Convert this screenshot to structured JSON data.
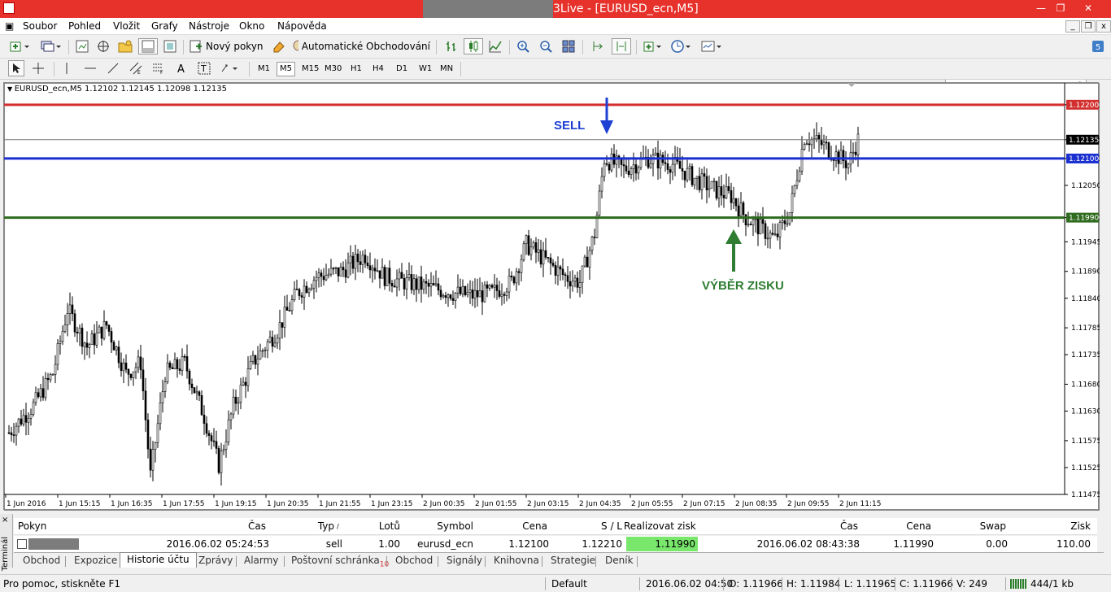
{
  "window": {
    "title": "3Live - [EURUSD_ecn,M5]",
    "close": "✕",
    "maximize": "❐",
    "minimize": "—"
  },
  "menu": {
    "items": [
      "Soubor",
      "Pohled",
      "Vložit",
      "Grafy",
      "Nástroje",
      "Okno",
      "Nápověda"
    ]
  },
  "toolbar": {
    "new_order": "Nový pokyn",
    "auto_trading": "Automatické Obchodování",
    "search_placeholder": ""
  },
  "timeframes": [
    "M1",
    "M5",
    "M15",
    "M30",
    "H1",
    "H4",
    "D1",
    "W1",
    "MN"
  ],
  "active_timeframe": "M5",
  "chart": {
    "header": "EURUSD_ecn,M5  1.12102 1.12145 1.12098 1.12135"
  },
  "annotations": {
    "sell": "SELL",
    "take_profit": "VÝBĚR ZISKU"
  },
  "colors": {
    "sell_arrow": "#1e3fd4",
    "tp_arrow": "#2e7d32",
    "tp_line": "#d32f2f",
    "entry_line": "#1a2fd0",
    "exit_line": "#2e6b1e",
    "title_bar": "#e7312b"
  },
  "chart_data": {
    "type": "candlestick",
    "symbol": "EURUSD_ecn",
    "timeframe": "M5",
    "ylim": [
      1.11475,
      1.1223
    ],
    "y_ticks": [
      "1.12200",
      "1.12135",
      "1.12100",
      "1.12050",
      "1.11990",
      "1.11945",
      "1.11890",
      "1.11840",
      "1.11785",
      "1.11735",
      "1.11680",
      "1.11630",
      "1.11575",
      "1.11525",
      "1.11475"
    ],
    "x_ticks": [
      "1 Jun 2016",
      "1 Jun 15:15",
      "1 Jun 16:35",
      "1 Jun 17:55",
      "1 Jun 19:15",
      "1 Jun 20:35",
      "1 Jun 21:55",
      "1 Jun 23:15",
      "2 Jun 00:35",
      "2 Jun 01:55",
      "2 Jun 03:15",
      "2 Jun 04:35",
      "2 Jun 05:55",
      "2 Jun 07:15",
      "2 Jun 08:35",
      "2 Jun 09:55",
      "2 Jun 11:15"
    ],
    "levels": [
      {
        "name": "Take Profit",
        "value": 1.122,
        "label": "1.12200",
        "color": "#d32f2f"
      },
      {
        "name": "Bid",
        "value": 1.12135,
        "label": "1.12135",
        "color": "#777777"
      },
      {
        "name": "Entry",
        "value": 1.121,
        "label": "1.12100",
        "color": "#1a2fd0"
      },
      {
        "name": "Exit",
        "value": 1.1199,
        "label": "1.11990",
        "color": "#2e6b1e"
      }
    ],
    "close_path": [
      [
        0,
        1.1159
      ],
      [
        10,
        1.1164
      ],
      [
        18,
        1.117
      ],
      [
        24,
        1.1182
      ],
      [
        32,
        1.1175
      ],
      [
        40,
        1.1179
      ],
      [
        48,
        1.117
      ],
      [
        54,
        1.1172
      ],
      [
        58,
        1.1151
      ],
      [
        64,
        1.117
      ],
      [
        72,
        1.1172
      ],
      [
        80,
        1.1162
      ],
      [
        86,
        1.1153
      ],
      [
        92,
        1.1164
      ],
      [
        100,
        1.1172
      ],
      [
        110,
        1.1178
      ],
      [
        118,
        1.1185
      ],
      [
        126,
        1.1188
      ],
      [
        136,
        1.1189
      ],
      [
        146,
        1.1192
      ],
      [
        154,
        1.1188
      ],
      [
        162,
        1.1187
      ],
      [
        172,
        1.1186
      ],
      [
        182,
        1.1185
      ],
      [
        190,
        1.11845
      ],
      [
        198,
        1.1185
      ],
      [
        206,
        1.1187
      ],
      [
        212,
        1.1194
      ],
      [
        220,
        1.1191
      ],
      [
        228,
        1.1188
      ],
      [
        234,
        1.1187
      ],
      [
        240,
        1.1196
      ],
      [
        244,
        1.121
      ],
      [
        252,
        1.1208
      ],
      [
        262,
        1.121
      ],
      [
        272,
        1.1209
      ],
      [
        282,
        1.1206
      ],
      [
        290,
        1.1204
      ],
      [
        296,
        1.1203
      ],
      [
        302,
        1.1199
      ],
      [
        308,
        1.1197
      ],
      [
        314,
        1.1195
      ],
      [
        320,
        1.12
      ],
      [
        326,
        1.1214
      ],
      [
        332,
        1.1213
      ],
      [
        338,
        1.1211
      ],
      [
        344,
        1.1209
      ],
      [
        348,
        1.12135
      ]
    ],
    "series": [
      {
        "name": "EURUSD_ecn",
        "open_last": 1.12102,
        "high_last": 1.12145,
        "low_last": 1.12098,
        "close_last": 1.12135
      }
    ]
  },
  "terminal": {
    "label": "Terminál",
    "close": "×",
    "columns": [
      "Pokyn",
      "Čas",
      "Typ",
      "Lotů",
      "Symbol",
      "Cena",
      "S / L",
      "Realizovat zisk",
      "Čas",
      "Cena",
      "Swap",
      "Zisk"
    ],
    "rows": [
      {
        "order": "",
        "open_time": "2016.06.02 05:24:53",
        "type": "sell",
        "lots": "1.00",
        "symbol": "eurusd_ecn",
        "open_price": "1.12100",
        "sl": "1.12210",
        "tp": "1.11990",
        "close_time": "2016.06.02 08:43:38",
        "close_price": "1.11990",
        "swap": "0.00",
        "profit": "110.00"
      }
    ],
    "tabs": [
      "Obchod",
      "Expozice",
      "Historie účtu",
      "Zprávy",
      "Alarmy",
      "Poštovní schránka",
      "Obchod",
      "Signály",
      "Knihovna",
      "Strategie",
      "Deník"
    ],
    "active_tab": "Historie účtu",
    "mailbox_count": "10"
  },
  "status": {
    "help": "Pro pomoc, stiskněte F1",
    "profile": "Default",
    "time": "2016.06.02 04:50",
    "open": "O: 1.11966",
    "high": "H: 1.11984",
    "low": "L: 1.11965",
    "close": "C: 1.11966",
    "volume": "V: 249",
    "traffic": "444/1 kb"
  }
}
